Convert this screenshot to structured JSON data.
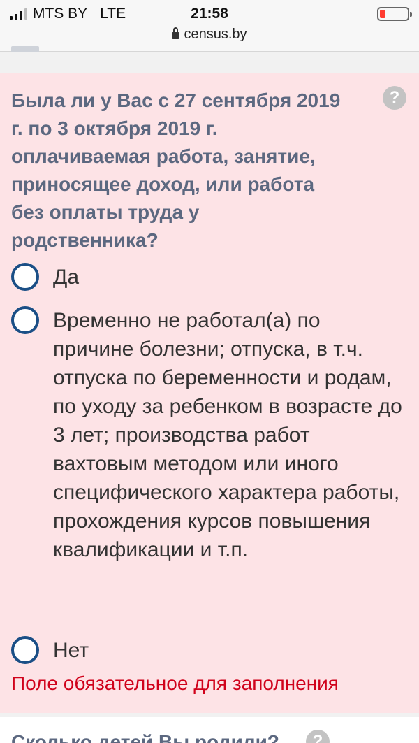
{
  "status_bar": {
    "carrier": "MTS BY",
    "network": "LTE",
    "time": "21:58",
    "url": "census.by",
    "battery_level": 0.2,
    "battery_color": "#ff3b30"
  },
  "question": {
    "title": "Была ли у Вас с 27 сентября 2019 г. по 3 октября 2019 г. оплачиваемая работа, занятие, приносящее доход, или работа без оплаты труда у родственника?",
    "help_icon": "?",
    "options": [
      {
        "label": "Да",
        "selected": false
      },
      {
        "label": "Временно не работал(а) по причине болезни; отпуска, в т.ч. отпуска по беременности и родам, по уходу за ребенком в возрасте до 3 лет; производства работ вахтовым методом или иного специфического характера работы, прохождения курсов повышения квалификации и т.п.",
        "selected": false
      },
      {
        "label": "Нет",
        "selected": false
      }
    ],
    "error": "Поле обязательное для заполнения"
  },
  "next_question": {
    "title": "Сколько детей Вы родили?",
    "help_icon": "?"
  },
  "colors": {
    "card_background": "#fde3e6",
    "title_color": "#5c6880",
    "radio_border": "#1b4f86",
    "error_color": "#d0021b"
  }
}
